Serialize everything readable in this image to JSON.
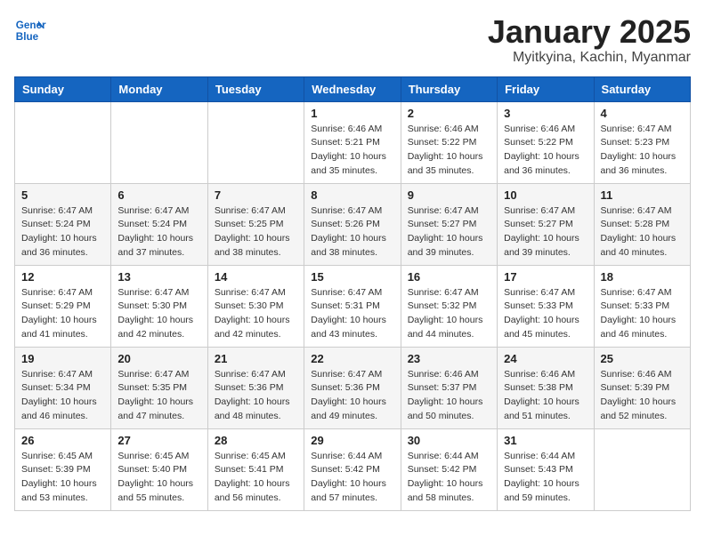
{
  "logo": {
    "line1": "General",
    "line2": "Blue"
  },
  "title": "January 2025",
  "location": "Myitkyina, Kachin, Myanmar",
  "days_of_week": [
    "Sunday",
    "Monday",
    "Tuesday",
    "Wednesday",
    "Thursday",
    "Friday",
    "Saturday"
  ],
  "weeks": [
    [
      {
        "day": null
      },
      {
        "day": null
      },
      {
        "day": null
      },
      {
        "day": "1",
        "sunrise": "6:46 AM",
        "sunset": "5:21 PM",
        "daylight": "10 hours and 35 minutes."
      },
      {
        "day": "2",
        "sunrise": "6:46 AM",
        "sunset": "5:22 PM",
        "daylight": "10 hours and 35 minutes."
      },
      {
        "day": "3",
        "sunrise": "6:46 AM",
        "sunset": "5:22 PM",
        "daylight": "10 hours and 36 minutes."
      },
      {
        "day": "4",
        "sunrise": "6:47 AM",
        "sunset": "5:23 PM",
        "daylight": "10 hours and 36 minutes."
      }
    ],
    [
      {
        "day": "5",
        "sunrise": "6:47 AM",
        "sunset": "5:24 PM",
        "daylight": "10 hours and 36 minutes."
      },
      {
        "day": "6",
        "sunrise": "6:47 AM",
        "sunset": "5:24 PM",
        "daylight": "10 hours and 37 minutes."
      },
      {
        "day": "7",
        "sunrise": "6:47 AM",
        "sunset": "5:25 PM",
        "daylight": "10 hours and 38 minutes."
      },
      {
        "day": "8",
        "sunrise": "6:47 AM",
        "sunset": "5:26 PM",
        "daylight": "10 hours and 38 minutes."
      },
      {
        "day": "9",
        "sunrise": "6:47 AM",
        "sunset": "5:27 PM",
        "daylight": "10 hours and 39 minutes."
      },
      {
        "day": "10",
        "sunrise": "6:47 AM",
        "sunset": "5:27 PM",
        "daylight": "10 hours and 39 minutes."
      },
      {
        "day": "11",
        "sunrise": "6:47 AM",
        "sunset": "5:28 PM",
        "daylight": "10 hours and 40 minutes."
      }
    ],
    [
      {
        "day": "12",
        "sunrise": "6:47 AM",
        "sunset": "5:29 PM",
        "daylight": "10 hours and 41 minutes."
      },
      {
        "day": "13",
        "sunrise": "6:47 AM",
        "sunset": "5:30 PM",
        "daylight": "10 hours and 42 minutes."
      },
      {
        "day": "14",
        "sunrise": "6:47 AM",
        "sunset": "5:30 PM",
        "daylight": "10 hours and 42 minutes."
      },
      {
        "day": "15",
        "sunrise": "6:47 AM",
        "sunset": "5:31 PM",
        "daylight": "10 hours and 43 minutes."
      },
      {
        "day": "16",
        "sunrise": "6:47 AM",
        "sunset": "5:32 PM",
        "daylight": "10 hours and 44 minutes."
      },
      {
        "day": "17",
        "sunrise": "6:47 AM",
        "sunset": "5:33 PM",
        "daylight": "10 hours and 45 minutes."
      },
      {
        "day": "18",
        "sunrise": "6:47 AM",
        "sunset": "5:33 PM",
        "daylight": "10 hours and 46 minutes."
      }
    ],
    [
      {
        "day": "19",
        "sunrise": "6:47 AM",
        "sunset": "5:34 PM",
        "daylight": "10 hours and 46 minutes."
      },
      {
        "day": "20",
        "sunrise": "6:47 AM",
        "sunset": "5:35 PM",
        "daylight": "10 hours and 47 minutes."
      },
      {
        "day": "21",
        "sunrise": "6:47 AM",
        "sunset": "5:36 PM",
        "daylight": "10 hours and 48 minutes."
      },
      {
        "day": "22",
        "sunrise": "6:47 AM",
        "sunset": "5:36 PM",
        "daylight": "10 hours and 49 minutes."
      },
      {
        "day": "23",
        "sunrise": "6:46 AM",
        "sunset": "5:37 PM",
        "daylight": "10 hours and 50 minutes."
      },
      {
        "day": "24",
        "sunrise": "6:46 AM",
        "sunset": "5:38 PM",
        "daylight": "10 hours and 51 minutes."
      },
      {
        "day": "25",
        "sunrise": "6:46 AM",
        "sunset": "5:39 PM",
        "daylight": "10 hours and 52 minutes."
      }
    ],
    [
      {
        "day": "26",
        "sunrise": "6:45 AM",
        "sunset": "5:39 PM",
        "daylight": "10 hours and 53 minutes."
      },
      {
        "day": "27",
        "sunrise": "6:45 AM",
        "sunset": "5:40 PM",
        "daylight": "10 hours and 55 minutes."
      },
      {
        "day": "28",
        "sunrise": "6:45 AM",
        "sunset": "5:41 PM",
        "daylight": "10 hours and 56 minutes."
      },
      {
        "day": "29",
        "sunrise": "6:44 AM",
        "sunset": "5:42 PM",
        "daylight": "10 hours and 57 minutes."
      },
      {
        "day": "30",
        "sunrise": "6:44 AM",
        "sunset": "5:42 PM",
        "daylight": "10 hours and 58 minutes."
      },
      {
        "day": "31",
        "sunrise": "6:44 AM",
        "sunset": "5:43 PM",
        "daylight": "10 hours and 59 minutes."
      },
      {
        "day": null
      }
    ]
  ]
}
